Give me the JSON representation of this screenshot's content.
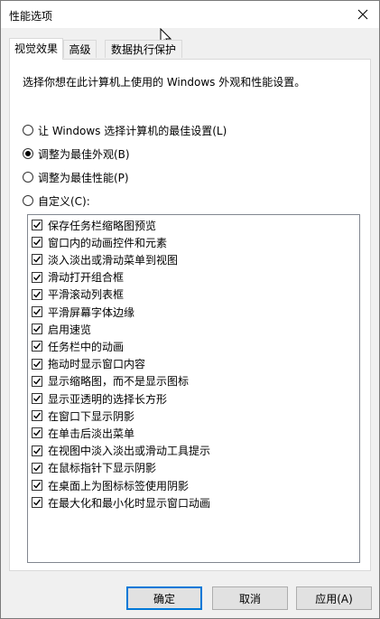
{
  "window": {
    "title": "性能选项"
  },
  "tabs": [
    {
      "label": "视觉效果"
    },
    {
      "label": "高级"
    },
    {
      "label": "数据执行保护"
    }
  ],
  "visual_effects": {
    "description": "选择你想在此计算机上使用的 Windows 外观和性能设置。",
    "options": [
      {
        "label": "让 Windows 选择计算机的最佳设置(L)",
        "selected": false
      },
      {
        "label": "调整为最佳外观(B)",
        "selected": true
      },
      {
        "label": "调整为最佳性能(P)",
        "selected": false
      },
      {
        "label": "自定义(C):",
        "selected": false
      }
    ],
    "effects": [
      {
        "label": "保存任务栏缩略图预览",
        "checked": true
      },
      {
        "label": "窗口内的动画控件和元素",
        "checked": true
      },
      {
        "label": "淡入淡出或滑动菜单到视图",
        "checked": true
      },
      {
        "label": "滑动打开组合框",
        "checked": true
      },
      {
        "label": "平滑滚动列表框",
        "checked": true
      },
      {
        "label": "平滑屏幕字体边缘",
        "checked": true
      },
      {
        "label": "启用速览",
        "checked": true
      },
      {
        "label": "任务栏中的动画",
        "checked": true
      },
      {
        "label": "拖动时显示窗口内容",
        "checked": true
      },
      {
        "label": "显示缩略图，而不是显示图标",
        "checked": true
      },
      {
        "label": "显示亚透明的选择长方形",
        "checked": true
      },
      {
        "label": "在窗口下显示阴影",
        "checked": true
      },
      {
        "label": "在单击后淡出菜单",
        "checked": true
      },
      {
        "label": "在视图中淡入淡出或滑动工具提示",
        "checked": true
      },
      {
        "label": "在鼠标指针下显示阴影",
        "checked": true
      },
      {
        "label": "在桌面上为图标标签使用阴影",
        "checked": true
      },
      {
        "label": "在最大化和最小化时显示窗口动画",
        "checked": true
      }
    ]
  },
  "buttons": {
    "ok": "确定",
    "cancel": "取消",
    "apply": "应用(A)"
  }
}
